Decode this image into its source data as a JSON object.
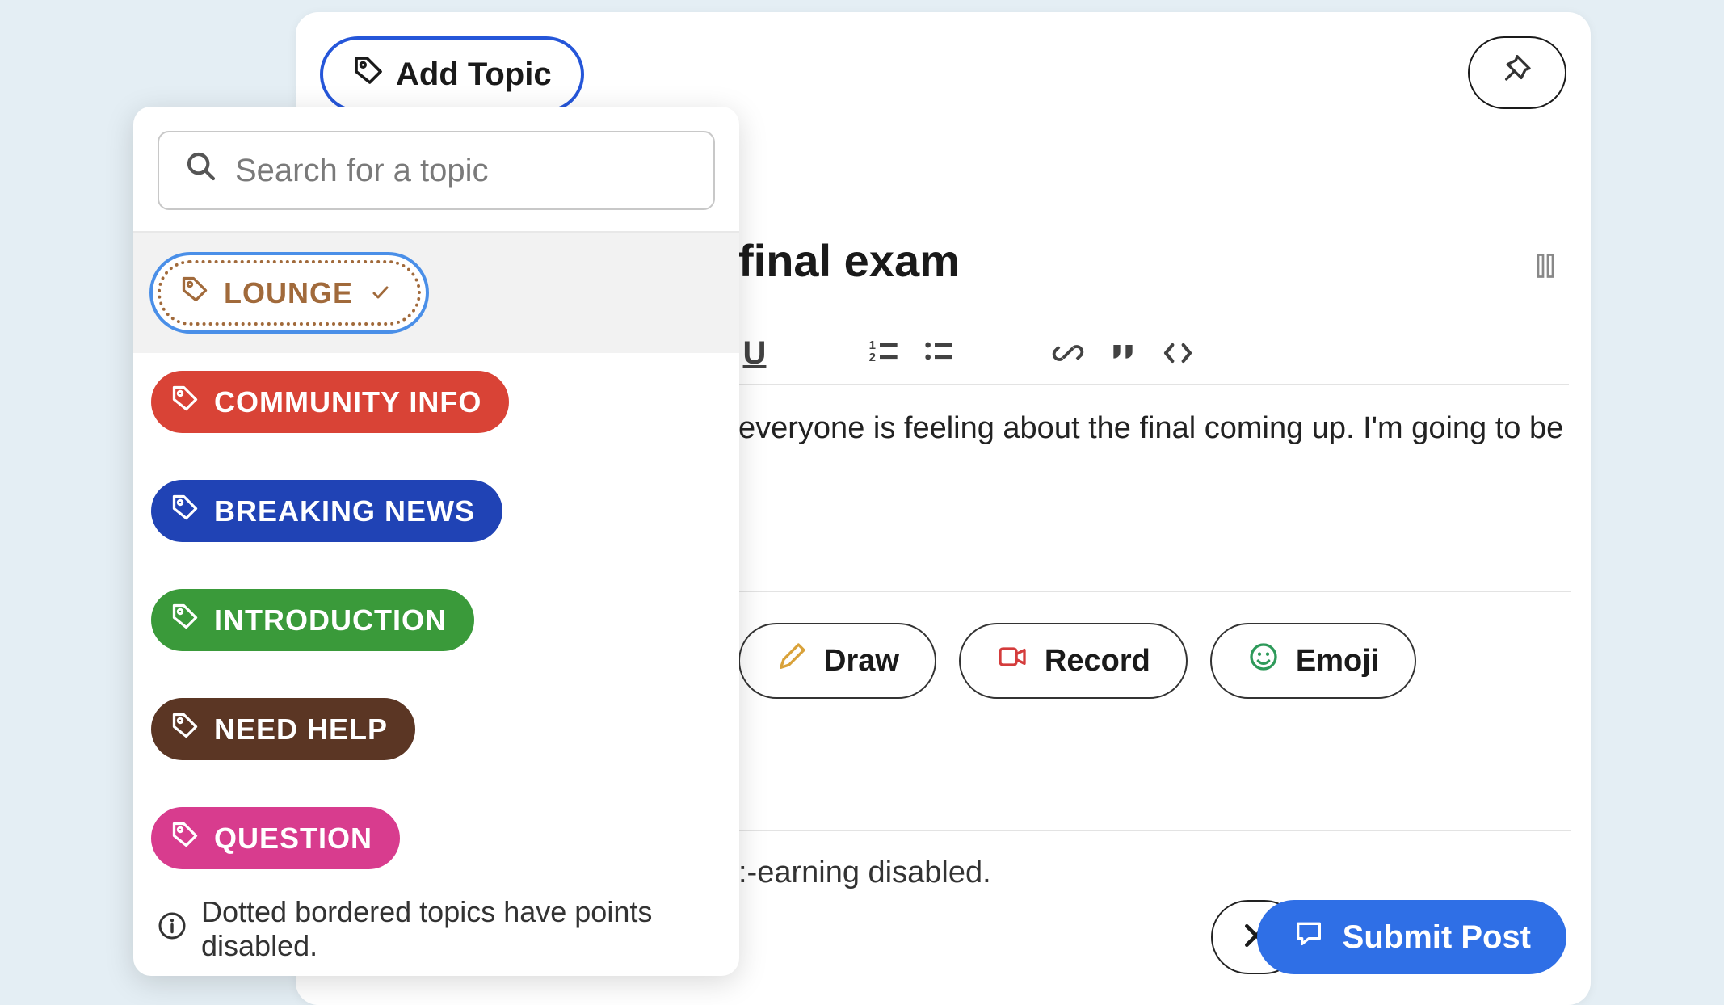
{
  "header": {
    "add_topic_label": "Add Topic",
    "pin_label": "Pin"
  },
  "post": {
    "title_fragment": "final exam",
    "body_fragment": "everyone is feeling about the final coming up. I'm going to be",
    "points_fragment": ":-earning disabled."
  },
  "toolbar": {
    "underline": "U",
    "ordered_list": "ol",
    "unordered_list": "ul",
    "link": "link",
    "quote": "quote",
    "code": "code"
  },
  "attachments": {
    "draw": "Draw",
    "record": "Record",
    "emoji": "Emoji"
  },
  "actions": {
    "cancel": "Cancel",
    "submit": "Submit Post"
  },
  "dropdown": {
    "search_placeholder": "Search for a topic",
    "selected": {
      "label": "LOUNGE"
    },
    "topics": [
      {
        "label": "COMMUNITY INFO",
        "class": "pill-red"
      },
      {
        "label": "BREAKING NEWS",
        "class": "pill-blue"
      },
      {
        "label": "INTRODUCTION",
        "class": "pill-green"
      },
      {
        "label": "NEED HELP",
        "class": "pill-brown"
      },
      {
        "label": "QUESTION",
        "class": "pill-pink"
      }
    ],
    "hint": "Dotted bordered topics have points disabled."
  }
}
